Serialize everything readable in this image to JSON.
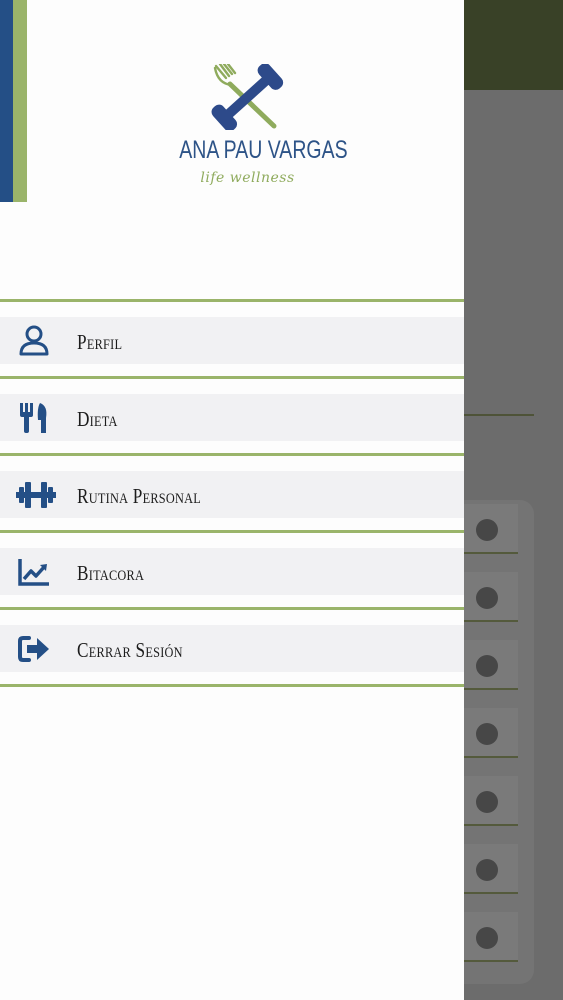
{
  "brand": {
    "name": "ANA PAU VARGAS",
    "tagline": "life wellness"
  },
  "colors": {
    "accent_blue": "#244f86",
    "accent_green": "#9ab46a",
    "header_dark": "#394127"
  },
  "menu": [
    {
      "label": "Perfil",
      "icon": "user-icon"
    },
    {
      "label": "Dieta",
      "icon": "utensils-icon"
    },
    {
      "label": "Rutina Personal",
      "icon": "dumbbell-icon"
    },
    {
      "label": "Bitacora",
      "icon": "chart-line-icon"
    },
    {
      "label": "Cerrar Sesión",
      "icon": "sign-out-icon"
    }
  ]
}
